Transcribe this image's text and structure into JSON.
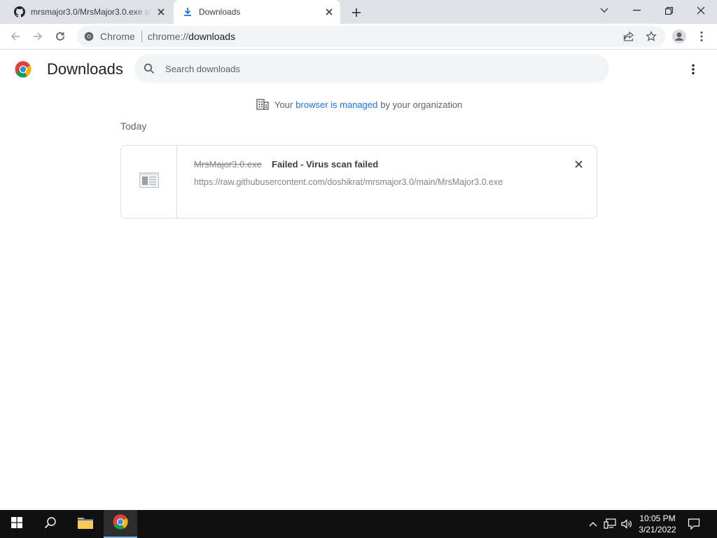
{
  "tabs": [
    {
      "title": "mrsmajor3.0/MrsMajor3.0.exe at",
      "icon": "github-icon"
    },
    {
      "title": "Downloads",
      "icon": "download-icon",
      "active": true
    }
  ],
  "omnibox": {
    "chip": "Chrome",
    "url_scheme": "chrome://",
    "url_host": "downloads"
  },
  "page": {
    "title": "Downloads",
    "search_placeholder": "Search downloads",
    "managed": {
      "prefix": "Your",
      "link": "browser is managed",
      "suffix": "by your organization"
    },
    "section": "Today"
  },
  "downloads": [
    {
      "filename": "MrsMajor3.0.exe",
      "status": "Failed - Virus scan failed",
      "url": "https://raw.githubusercontent.com/doshikrat/mrsmajor3.0/main/MrsMajor3.0.exe"
    }
  ],
  "taskbar": {
    "time": "10:05 PM",
    "date": "3/21/2022"
  },
  "colors": {
    "accent": "#1a73e8",
    "tabstrip": "#dee1e6",
    "taskbar": "#101010"
  }
}
